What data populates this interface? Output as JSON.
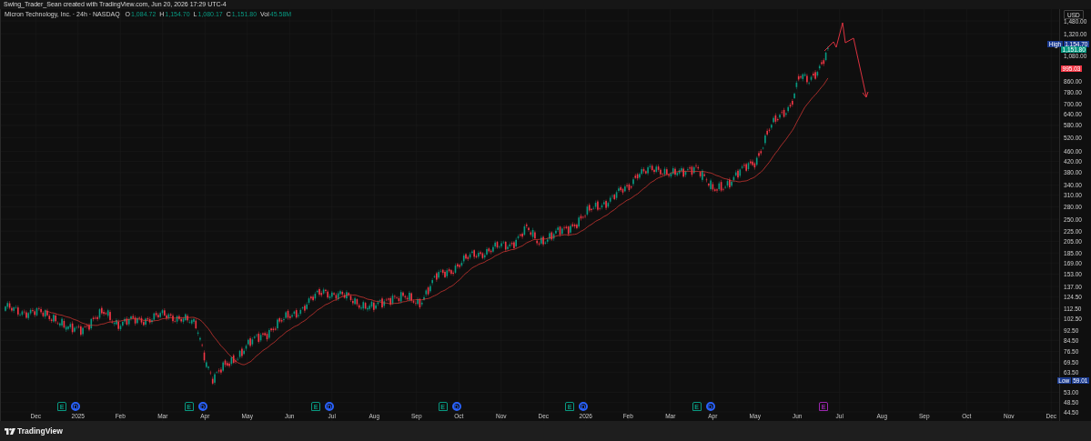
{
  "header": {
    "text": "Swing_Trader_Sean created with TradingView.com, Jun 20, 2026 17:29 UTC-4"
  },
  "legend": {
    "title": "Micron Technology, Inc. · 24h · NASDAQ",
    "values": [
      {
        "label": "O",
        "value": "1,084.72"
      },
      {
        "label": "H",
        "value": "1,154.70"
      },
      {
        "label": "L",
        "value": "1,080.17"
      },
      {
        "label": "C",
        "value": "1,151.80"
      },
      {
        "label": "Vol",
        "value": "45.58M"
      }
    ]
  },
  "price_axis": {
    "currency": "USD",
    "labels": [
      {
        "kind": "tick",
        "text": "1,480.00"
      },
      {
        "kind": "tick",
        "text": "1,320.00"
      },
      {
        "kind": "high",
        "label": "High",
        "text": "1,154.70"
      },
      {
        "kind": "last",
        "text": "1,151.80"
      },
      {
        "kind": "tick",
        "text": "1,080.00"
      },
      {
        "kind": "target",
        "text": "995.03"
      },
      {
        "kind": "tick",
        "text": "860.00"
      },
      {
        "kind": "tick",
        "text": "780.00"
      },
      {
        "kind": "tick",
        "text": "700.00"
      },
      {
        "kind": "tick",
        "text": "640.00"
      },
      {
        "kind": "tick",
        "text": "580.00"
      },
      {
        "kind": "tick",
        "text": "520.00"
      },
      {
        "kind": "tick",
        "text": "460.00"
      },
      {
        "kind": "tick",
        "text": "420.00"
      },
      {
        "kind": "tick",
        "text": "380.00"
      },
      {
        "kind": "tick",
        "text": "340.00"
      },
      {
        "kind": "tick",
        "text": "310.00"
      },
      {
        "kind": "tick",
        "text": "280.00"
      },
      {
        "kind": "tick",
        "text": "250.00"
      },
      {
        "kind": "tick",
        "text": "225.00"
      },
      {
        "kind": "tick",
        "text": "205.00"
      },
      {
        "kind": "tick",
        "text": "185.00"
      },
      {
        "kind": "tick",
        "text": "169.00"
      },
      {
        "kind": "tick",
        "text": "153.00"
      },
      {
        "kind": "tick",
        "text": "137.00"
      },
      {
        "kind": "tick",
        "text": "124.50"
      },
      {
        "kind": "tick",
        "text": "112.50"
      },
      {
        "kind": "tick",
        "text": "102.50"
      },
      {
        "kind": "tick",
        "text": "92.50"
      },
      {
        "kind": "tick",
        "text": "84.50"
      },
      {
        "kind": "tick",
        "text": "76.50"
      },
      {
        "kind": "tick",
        "text": "69.50"
      },
      {
        "kind": "tick",
        "text": "63.50"
      },
      {
        "kind": "low",
        "label": "Low",
        "text": "59.01"
      },
      {
        "kind": "tick",
        "text": "53.00"
      },
      {
        "kind": "tick",
        "text": "48.50"
      },
      {
        "kind": "tick",
        "text": "44.50"
      }
    ]
  },
  "time_axis": [
    {
      "label": "Dec",
      "events": [
        {
          "kind": "earnings",
          "label": "E",
          "color": "#089981"
        },
        {
          "kind": "dividend",
          "label": "D",
          "color": "#2962ff"
        }
      ]
    },
    {
      "label": "2025"
    },
    {
      "label": "Feb"
    },
    {
      "label": "Mar",
      "events": [
        {
          "kind": "earnings",
          "label": "E",
          "color": "#089981"
        },
        {
          "kind": "dividend",
          "label": "D",
          "color": "#2962ff"
        }
      ]
    },
    {
      "label": "Apr"
    },
    {
      "label": "May"
    },
    {
      "label": "Jun",
      "events": [
        {
          "kind": "earnings",
          "label": "E",
          "color": "#089981"
        },
        {
          "kind": "dividend",
          "label": "D",
          "color": "#2962ff"
        }
      ]
    },
    {
      "label": "Jul"
    },
    {
      "label": "Aug"
    },
    {
      "label": "Sep",
      "events": [
        {
          "kind": "earnings",
          "label": "E",
          "color": "#089981"
        },
        {
          "kind": "dividend",
          "label": "D",
          "color": "#2962ff"
        }
      ]
    },
    {
      "label": "Oct"
    },
    {
      "label": "Nov"
    },
    {
      "label": "Dec",
      "events": [
        {
          "kind": "earnings",
          "label": "E",
          "color": "#089981"
        },
        {
          "kind": "dividend",
          "label": "D",
          "color": "#2962ff"
        }
      ]
    },
    {
      "label": "2026"
    },
    {
      "label": "Feb"
    },
    {
      "label": "Mar",
      "events": [
        {
          "kind": "earnings",
          "label": "E",
          "color": "#089981"
        },
        {
          "kind": "dividend",
          "label": "D",
          "color": "#2962ff"
        }
      ]
    },
    {
      "label": "Apr"
    },
    {
      "label": "May"
    },
    {
      "label": "Jun",
      "events": [
        {
          "kind": "earnings",
          "label": "E",
          "color": "#9c27b0"
        }
      ]
    },
    {
      "label": "Jul"
    },
    {
      "label": "Aug"
    },
    {
      "label": "Sep"
    },
    {
      "label": "Oct"
    },
    {
      "label": "Nov"
    },
    {
      "label": "Dec"
    }
  ],
  "footer": {
    "brand": "TradingView"
  }
}
